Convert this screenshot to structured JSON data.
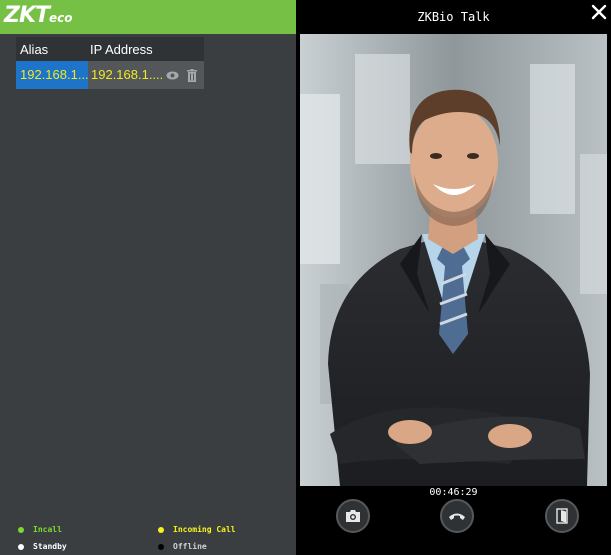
{
  "brand": {
    "logo_main": "ZKT",
    "logo_small": "eco"
  },
  "device_table": {
    "columns": [
      "Alias",
      "IP Address"
    ],
    "rows": [
      {
        "alias": "192.168.1....",
        "ip": "192.168.1...."
      }
    ]
  },
  "legend": [
    {
      "label": "Incall",
      "color": "#7dd92f"
    },
    {
      "label": "Incoming Call",
      "color": "#f5f31b"
    },
    {
      "label": "Standby",
      "color": "#ffffff"
    },
    {
      "label": "Offline",
      "color": "#000000"
    }
  ],
  "talk": {
    "title": "ZKBio Talk",
    "timer": "00:46:29"
  },
  "icons": {
    "preview": "eye-icon",
    "delete": "trash-icon",
    "close": "close-icon",
    "snapshot": "camera-icon",
    "hangup": "hangup-icon",
    "unlock": "door-icon"
  },
  "colors": {
    "brand": "#75c045",
    "selection": "#1e74c9",
    "ip_text": "#f0ea25"
  }
}
